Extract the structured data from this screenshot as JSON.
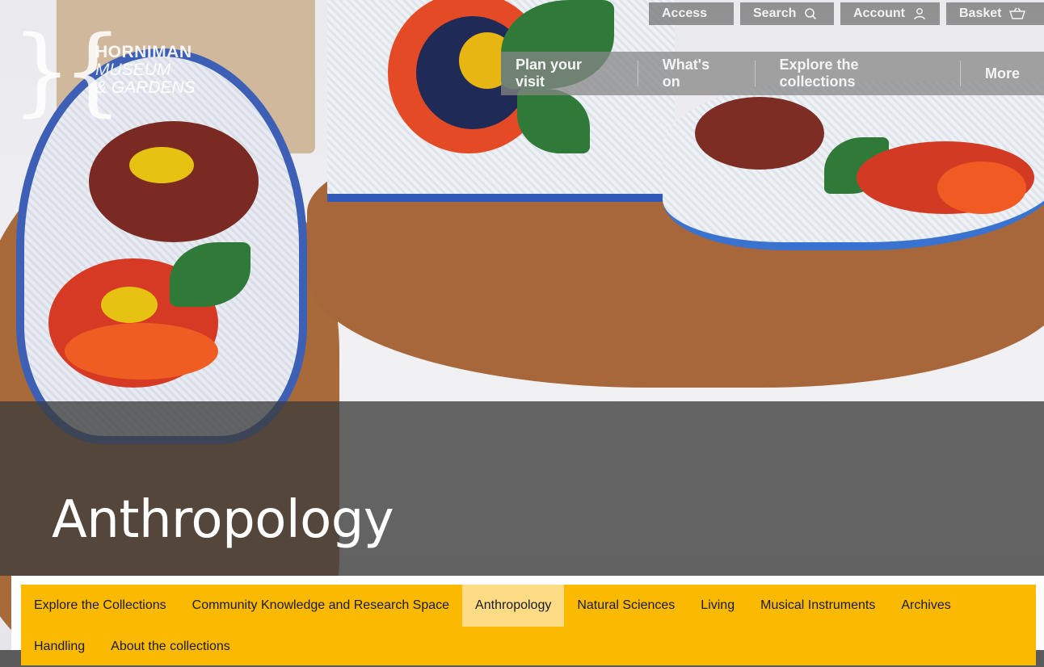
{
  "logo": {
    "mark": "}{",
    "line1": "HORNIMAN",
    "line2": "MUSEUM",
    "line3": "& GARDENS"
  },
  "utility_nav": {
    "access": "Access",
    "search": "Search",
    "account": "Account",
    "basket": "Basket"
  },
  "main_nav": {
    "items": [
      {
        "label": "Plan your visit"
      },
      {
        "label": "What's on"
      },
      {
        "label": "Explore the collections"
      },
      {
        "label": "More"
      }
    ]
  },
  "hero": {
    "title": "Anthropology"
  },
  "sub_nav": {
    "items": [
      {
        "label": "Explore the Collections"
      },
      {
        "label": "Community Knowledge and Research Space"
      },
      {
        "label": "Anthropology",
        "active": true
      },
      {
        "label": "Natural Sciences"
      },
      {
        "label": "Living"
      },
      {
        "label": "Musical Instruments"
      },
      {
        "label": "Archives"
      },
      {
        "label": "Handling"
      },
      {
        "label": "About the collections"
      }
    ]
  },
  "colors": {
    "subnav_bg": "#fbba00",
    "subnav_active": "#fddc85",
    "overlay": "#3c3c3c"
  }
}
